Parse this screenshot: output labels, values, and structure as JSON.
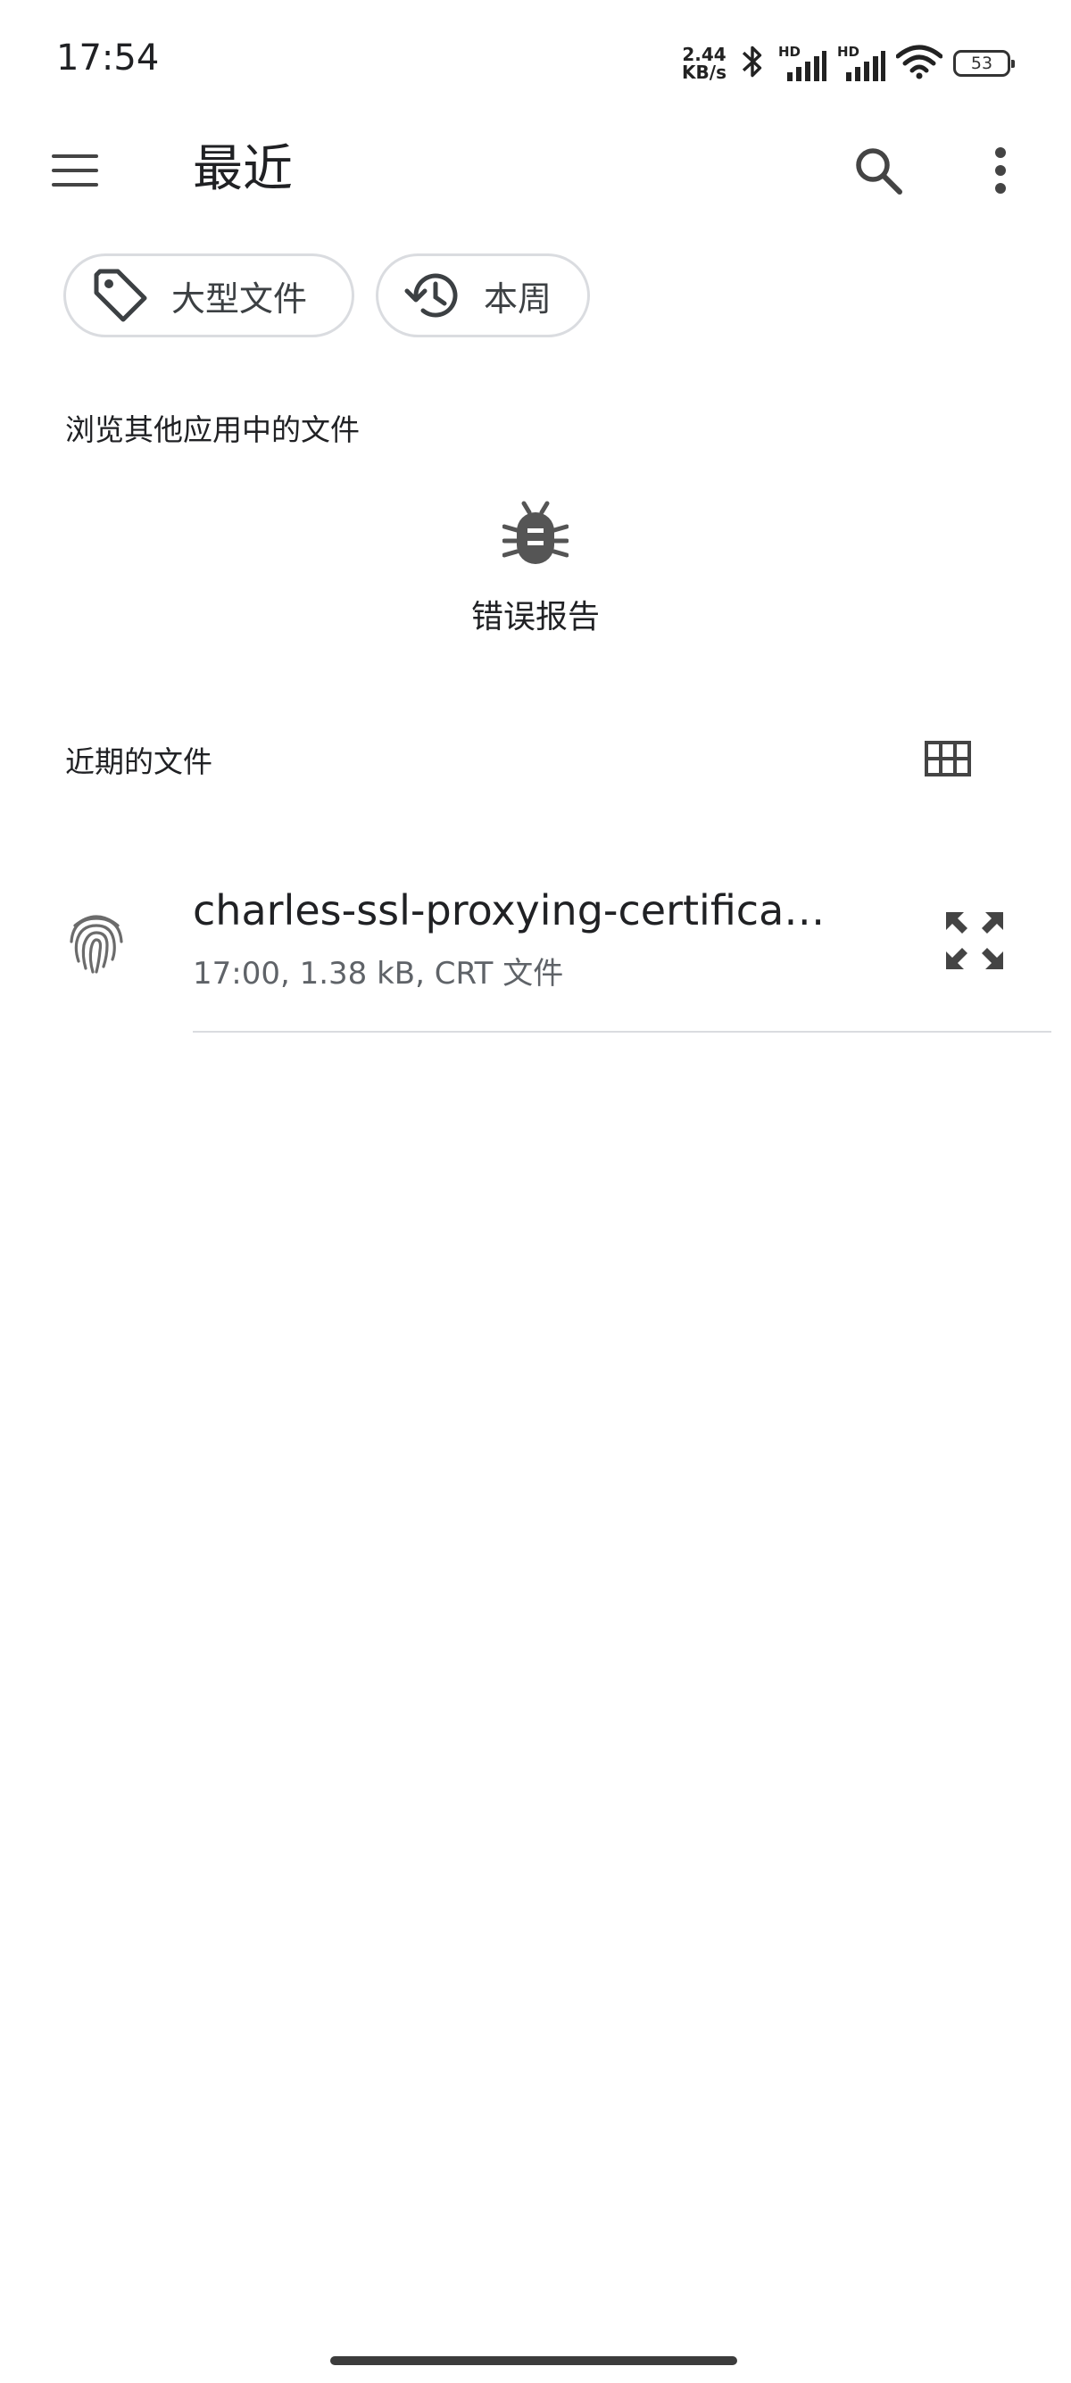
{
  "status_bar": {
    "time": "17:54",
    "net_speed_value": "2.44",
    "net_speed_unit": "KB/s",
    "sim1_label": "HD",
    "sim2_label": "HD",
    "battery": "53",
    "icons": [
      "bluetooth-icon",
      "signal-icon",
      "signal-icon",
      "wifi-icon",
      "battery-icon"
    ]
  },
  "app_bar": {
    "title": "最近",
    "menu_icon": "menu-icon",
    "search_icon": "search-icon",
    "more_icon": "more-vert-icon"
  },
  "chips": [
    {
      "label": "大型文件",
      "icon": "label-tag-icon"
    },
    {
      "label": "本周",
      "icon": "history-icon"
    }
  ],
  "browse_section": {
    "label": "浏览其他应用中的文件",
    "apps": [
      {
        "name": "错误报告",
        "icon": "bug-icon"
      }
    ]
  },
  "recent_section": {
    "label": "近期的文件",
    "view_toggle_icon": "grid-view-icon"
  },
  "files": [
    {
      "name": "charles-ssl-proxying-certifica…",
      "meta": "17:00, 1.38 kB, CRT 文件",
      "icon": "fingerprint-icon",
      "action_icon": "expand-icon"
    }
  ],
  "colors": {
    "text_primary": "#202124",
    "text_secondary": "#5f6368",
    "chip_border": "#dadce0",
    "icon": "#5f6368"
  }
}
